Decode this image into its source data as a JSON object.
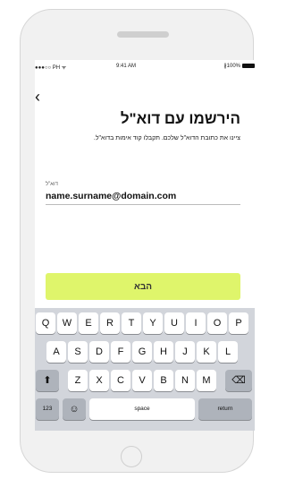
{
  "status": {
    "carrier": "●●●○○ PH ᯤ",
    "time": "9:41 AM",
    "battery": "∦100%"
  },
  "nav": {
    "back_icon": "‹"
  },
  "title": "הירשמו עם דוא\"ל",
  "subtitle": "ציינו את כתובת הדוא\"ל שלכם. תקבלו קוד אימות בדוא\"ל.",
  "field": {
    "label": "דוא\"ל",
    "value": "name.surname@domain.com"
  },
  "next_button": "הבא",
  "keyboard": {
    "row1": [
      "Q",
      "W",
      "E",
      "R",
      "T",
      "Y",
      "U",
      "I",
      "O",
      "P"
    ],
    "row2": [
      "A",
      "S",
      "D",
      "F",
      "G",
      "H",
      "J",
      "K",
      "L"
    ],
    "row3": [
      "Z",
      "X",
      "C",
      "V",
      "B",
      "N",
      "M"
    ],
    "numbers": "123",
    "emoji": "☺",
    "space": "space",
    "return": "return",
    "shift": "⬆",
    "delete": "⌫"
  },
  "colors": {
    "accent": "#dff56b",
    "keyboard_bg": "#d2d5db",
    "frame": "#f1f1f1"
  }
}
